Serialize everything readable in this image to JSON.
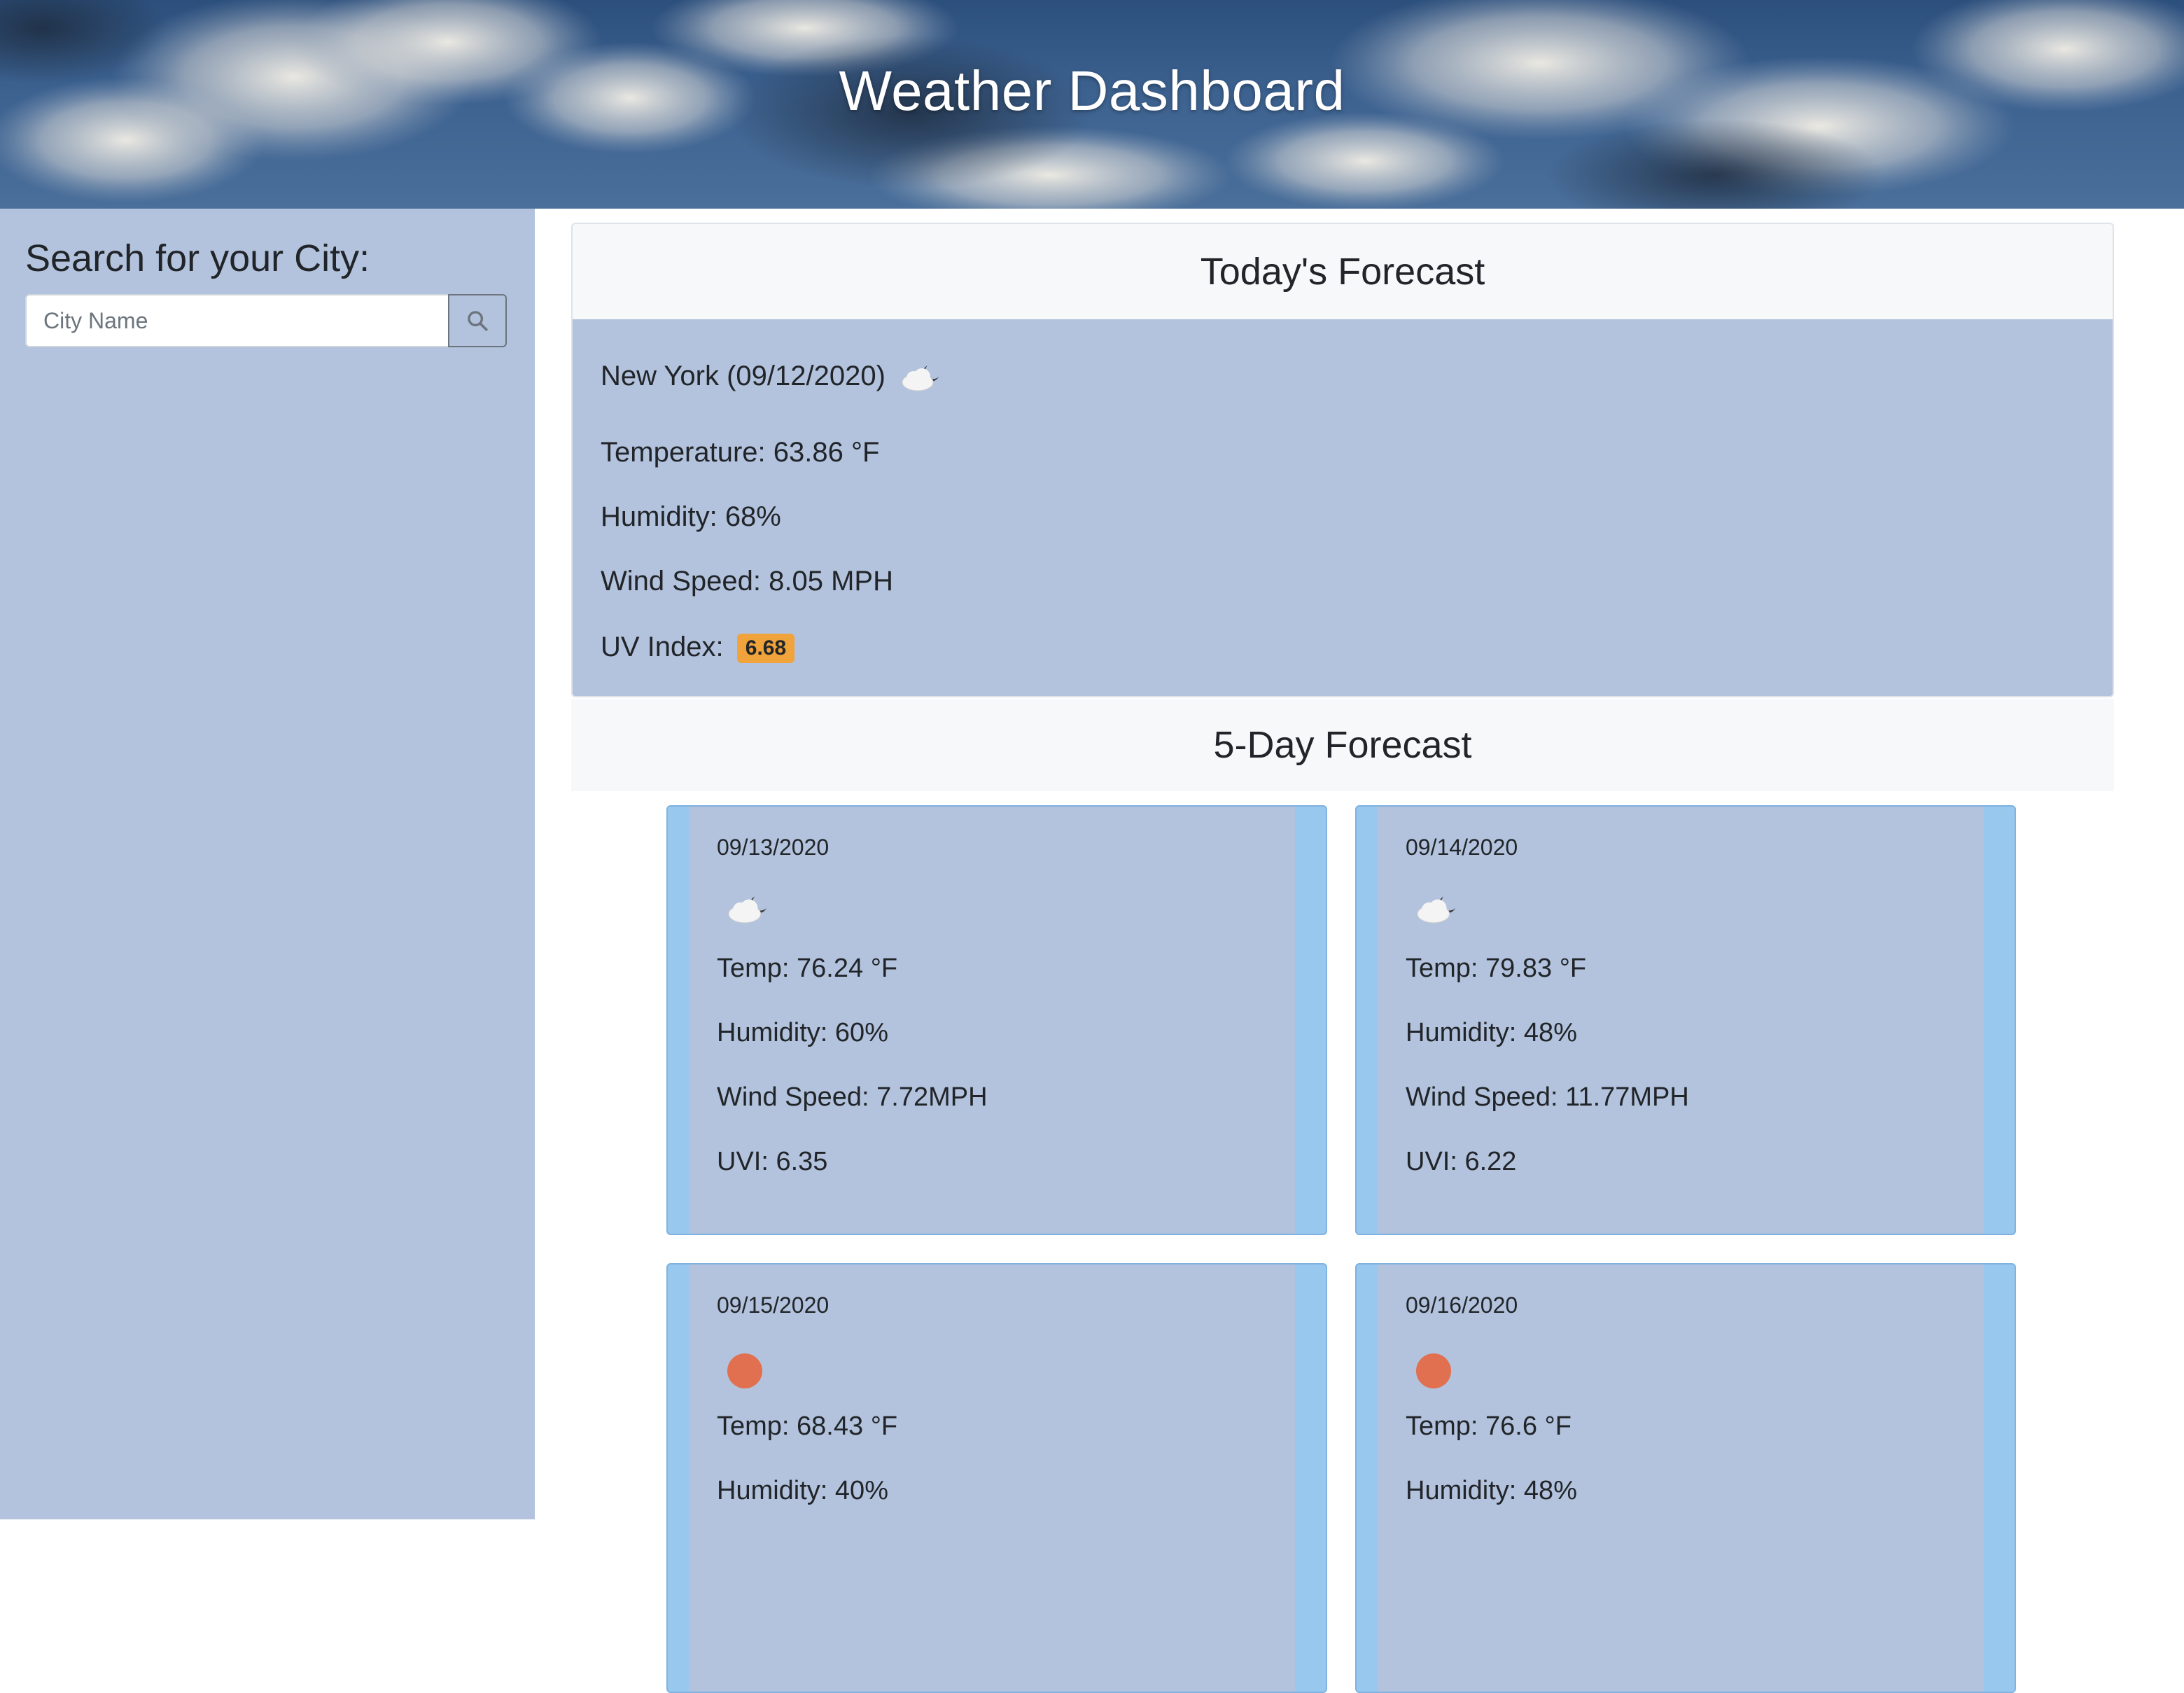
{
  "header": {
    "title": "Weather Dashboard"
  },
  "sidebar": {
    "heading": "Search for your City:",
    "search": {
      "placeholder": "City Name",
      "value": "",
      "button_icon": "search-icon"
    }
  },
  "today": {
    "header": "Today's Forecast",
    "city_line": "New York (09/12/2020)",
    "icon": "cloudy-night-icon",
    "temperature": "Temperature: 63.86 °F",
    "humidity": "Humidity: 68%",
    "wind": "Wind Speed: 8.05 MPH",
    "uv_label": "UV Index:",
    "uv_value": "6.68",
    "uv_color": "#f0a33b"
  },
  "forecast": {
    "header": "5-Day Forecast",
    "days": [
      {
        "date": "09/13/2020",
        "icon": "cloudy-night-icon",
        "temp": "Temp: 76.24 °F",
        "humidity": "Humidity: 60%",
        "wind": "Wind Speed: 7.72MPH",
        "uvi": "UVI: 6.35"
      },
      {
        "date": "09/14/2020",
        "icon": "cloudy-night-icon",
        "temp": "Temp: 79.83 °F",
        "humidity": "Humidity: 48%",
        "wind": "Wind Speed: 11.77MPH",
        "uvi": "UVI: 6.22"
      },
      {
        "date": "09/15/2020",
        "icon": "clear-sun-icon",
        "temp": "Temp: 68.43 °F",
        "humidity": "Humidity: 40%"
      },
      {
        "date": "09/16/2020",
        "icon": "clear-sun-icon",
        "temp": "Temp: 76.6 °F",
        "humidity": "Humidity: 48%"
      }
    ]
  },
  "colors": {
    "sidebar_bg": "#b3c3dd",
    "card_accent": "#99c8ef",
    "sun": "#e07050",
    "uv_moderate": "#f0a33b"
  }
}
